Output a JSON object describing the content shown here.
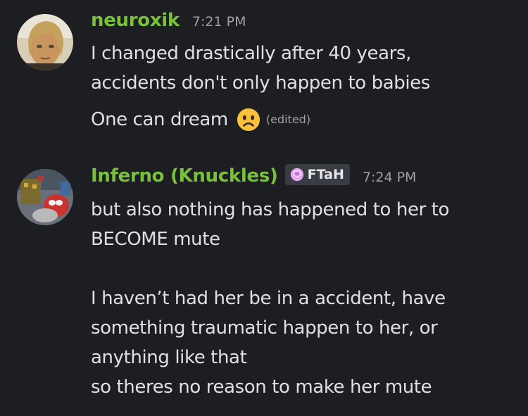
{
  "messages": [
    {
      "username": "neuroxik",
      "username_color": "#78c13a",
      "timestamp": "7:21 PM",
      "avatar_icon": "user-avatar-icon",
      "lines": [
        "I changed drastically after 40 years,",
        "accidents don't only happen to babies"
      ],
      "edited_line": "One can dream",
      "emoji": "frowning-face-emoji",
      "edited_label": "(edited)"
    },
    {
      "username": "Inferno (Knuckles)",
      "username_color": "#78c13a",
      "timestamp": "7:24 PM",
      "avatar_icon": "user-avatar-icon",
      "tag_icon": "pink-shield-icon",
      "tag_label": "FTaH",
      "lines": [
        "but also nothing has happened to her to",
        "BECOME mute",
        "",
        "I haven’t had her be in a accident, have",
        "something traumatic happen to her, or",
        "anything like that",
        "so theres no reason to make her mute"
      ]
    }
  ],
  "colors": {
    "background": "#1d1e22",
    "text": "#dfe0e4",
    "muted": "#9fa1a8",
    "tag_bg": "#3a3c43"
  }
}
